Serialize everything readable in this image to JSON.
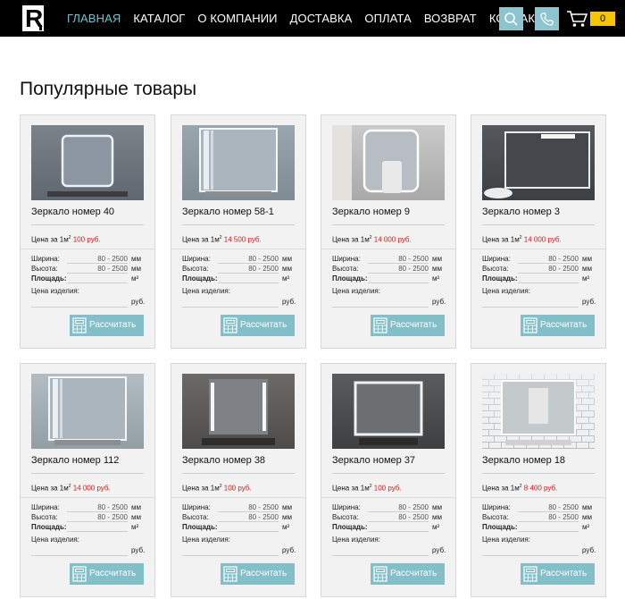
{
  "header": {
    "logo_letter": "R",
    "nav": [
      {
        "label": "ГЛАВНАЯ",
        "active": true
      },
      {
        "label": "КАТАЛОГ",
        "active": false
      },
      {
        "label": "О КОМПАНИИ",
        "active": false
      },
      {
        "label": "ДОСТАВКА",
        "active": false
      },
      {
        "label": "ОПЛАТА",
        "active": false
      },
      {
        "label": "ВОЗВРАТ",
        "active": false
      },
      {
        "label": "КОНТАКТЫ",
        "active": false
      }
    ],
    "search_icon": "search-icon",
    "phone_icon": "phone-icon",
    "cart_icon": "cart-icon",
    "cart_count": "0",
    "accent_color": "#6dc3d0",
    "badge_color": "#f7c600"
  },
  "main": {
    "title": "Популярные товары",
    "labels": {
      "price_prefix": "Цена за 1м",
      "price_sup": "2",
      "width": "Ширина:",
      "height": "Высота:",
      "area": "Площадь:",
      "product_price": "Цена изделия:",
      "range": "80 - 2500",
      "unit_mm": "мм",
      "unit_m2": "м²",
      "unit_rub": "руб.",
      "button": "Рассчитать"
    },
    "products": [
      {
        "name": "Зеркало номер 40",
        "price": "100 руб.",
        "image": "square-lit-mirror"
      },
      {
        "name": "Зеркало номер 58-1",
        "price": "14 500 руб.",
        "image": "side-lit-mirror"
      },
      {
        "name": "Зеркало номер 9",
        "price": "14 000 руб.",
        "image": "rounded-mirror-bathroom"
      },
      {
        "name": "Зеркало номер 3",
        "price": "14 000 руб.",
        "image": "top-lit-mirror"
      },
      {
        "name": "Зеркало номер 112",
        "price": "14 000 руб.",
        "image": "side-lit-mirror-2"
      },
      {
        "name": "Зеркало номер 38",
        "price": "100 руб.",
        "image": "twin-strip-mirror"
      },
      {
        "name": "Зеркало номер 37",
        "price": "100 руб.",
        "image": "frame-lit-mirror"
      },
      {
        "name": "Зеркало номер 18",
        "price": "8 400 руб.",
        "image": "tile-mirror"
      }
    ]
  }
}
